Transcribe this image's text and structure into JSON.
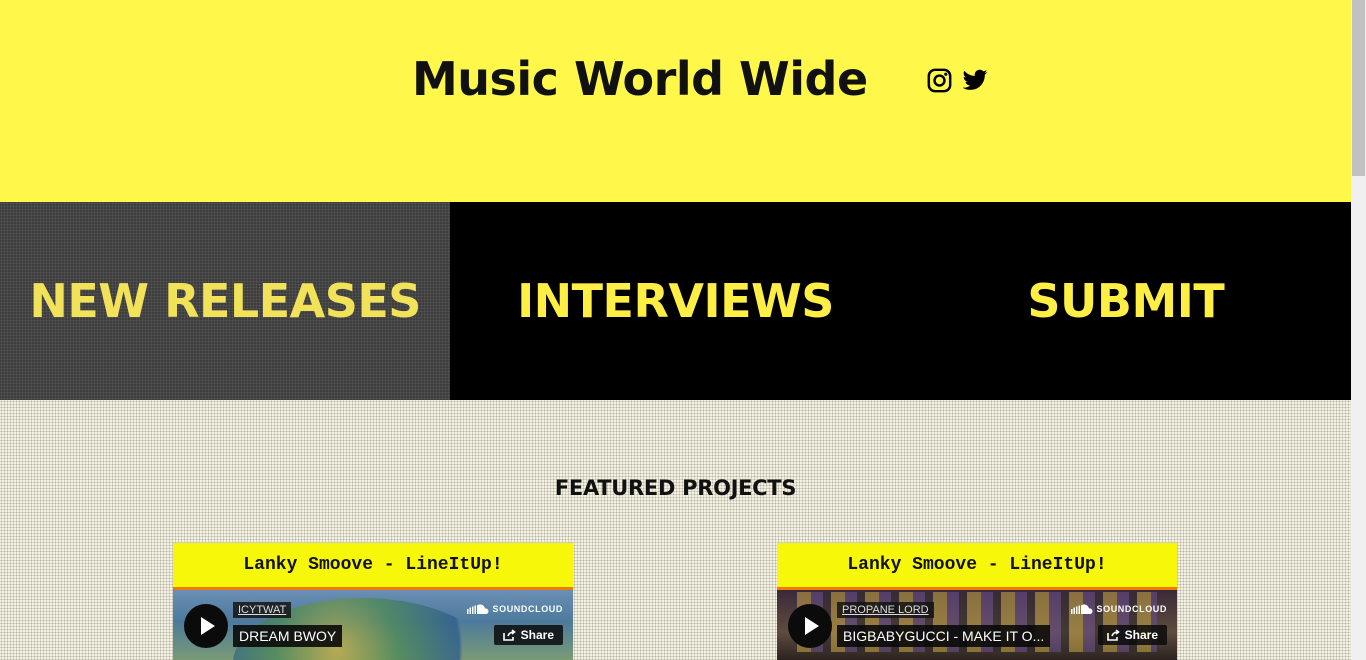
{
  "header": {
    "site_title": "Music World Wide",
    "social": [
      {
        "icon": "instagram-icon"
      },
      {
        "icon": "twitter-icon"
      }
    ]
  },
  "nav": {
    "items": [
      {
        "label": "NEW RELEASES",
        "active": true
      },
      {
        "label": "INTERVIEWS",
        "active": false
      },
      {
        "label": "SUBMIT",
        "active": false
      }
    ]
  },
  "featured": {
    "heading": "FEATURED PROJECTS",
    "cards": [
      {
        "title": "Lanky Smoove - LineItUp!",
        "artist": "ICYTWAT",
        "track": "DREAM BWOY",
        "brand": "SOUNDCLOUD",
        "share_label": "Share"
      },
      {
        "title": "Lanky Smoove - LineItUp!",
        "artist": "PROPANE LORD",
        "track": "BIGBABYGUCCI - MAKE IT O...",
        "brand": "SOUNDCLOUD",
        "share_label": "Share"
      }
    ]
  },
  "colors": {
    "header_bg": "#fff84a",
    "nav_bg": "#000000",
    "nav_active_bg": "#3d3d3d",
    "nav_text": "#ffee44",
    "card_title_bg": "#f7f70a",
    "card_title_border": "#f07b00"
  }
}
